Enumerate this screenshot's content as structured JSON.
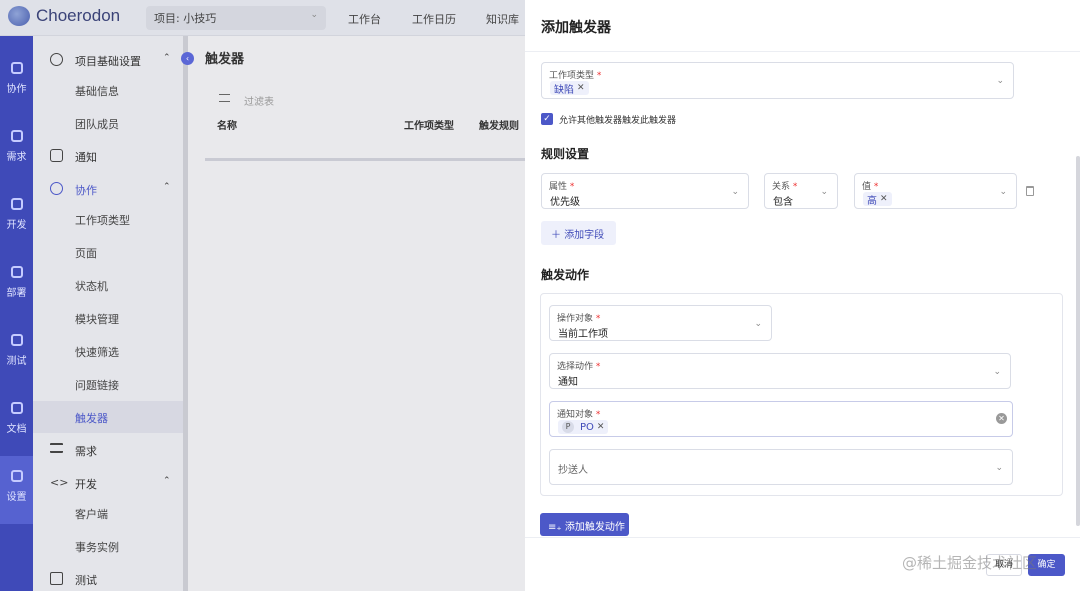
{
  "app": {
    "name": "Choerodon"
  },
  "topbar": {
    "project_select": "项目: 小技巧",
    "nav": [
      "工作台",
      "工作日历",
      "知识库"
    ]
  },
  "rail": [
    {
      "label": "协作",
      "icon": "collab-icon"
    },
    {
      "label": "需求",
      "icon": "layers-icon"
    },
    {
      "label": "开发",
      "icon": "code-icon"
    },
    {
      "label": "部署",
      "icon": "deploy-icon"
    },
    {
      "label": "测试",
      "icon": "test-icon"
    },
    {
      "label": "文档",
      "icon": "doc-icon"
    },
    {
      "label": "设置",
      "icon": "settings-icon"
    }
  ],
  "sidebar": {
    "groups": [
      {
        "label": "项目基础设置",
        "children": [
          "基础信息",
          "团队成员"
        ]
      },
      {
        "label": "通知"
      },
      {
        "label": "协作",
        "children": [
          "工作项类型",
          "页面",
          "状态机",
          "模块管理",
          "快速筛选",
          "问题链接",
          "触发器"
        ]
      },
      {
        "label": "需求"
      },
      {
        "label": "开发",
        "children": [
          "客户端",
          "事务实例"
        ]
      },
      {
        "label": "测试"
      }
    ],
    "active": "触发器"
  },
  "main": {
    "title": "触发器",
    "filter_placeholder": "过滤表",
    "columns": [
      "名称",
      "工作项类型",
      "触发规则"
    ]
  },
  "drawer": {
    "title": "添加触发器",
    "issue_type": {
      "label": "工作项类型",
      "tags": [
        "缺陷"
      ]
    },
    "allow_other": "允许其他触发器触发此触发器",
    "rules_title": "规则设置",
    "rule": {
      "attr_label": "属性",
      "attr_value": "优先级",
      "rel_label": "关系",
      "rel_value": "包含",
      "val_label": "值",
      "val_tag": "高"
    },
    "add_field": "添加字段",
    "actions_title": "触发动作",
    "action": {
      "target_label": "操作对象",
      "target_value": "当前工作项",
      "action_label": "选择动作",
      "action_value": "通知",
      "notify_label": "通知对象",
      "notify_avatar": "P",
      "notify_tag": "PO",
      "cc_placeholder": "抄送人"
    },
    "add_action": "添加触发动作",
    "cancel": "取消",
    "ok": "确定"
  },
  "watermark": "@稀土掘金技术社区"
}
